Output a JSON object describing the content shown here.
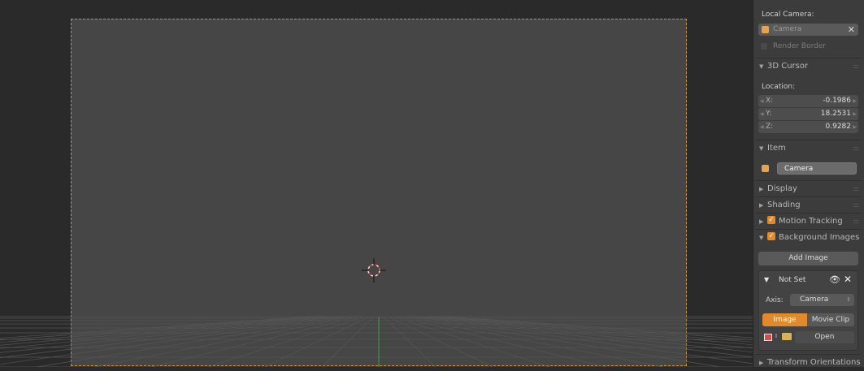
{
  "viewport": {
    "frame_color": "#c8903f",
    "grid_axis_color": "#3aa03a"
  },
  "panel": {
    "local_camera_label": "Local Camera:",
    "local_camera_value": "Camera",
    "render_border_label": "Render Border",
    "cursor_section": "3D Cursor",
    "location_label": "Location:",
    "x_label": "X:",
    "x_value": "-0.1986",
    "y_label": "Y:",
    "y_value": "18.2531",
    "z_label": "Z:",
    "z_value": "0.9282",
    "item_section": "Item",
    "item_name": "Camera",
    "display_section": "Display",
    "shading_section": "Shading",
    "motion_tracking_section": "Motion Tracking",
    "background_images_section": "Background Images",
    "add_image_label": "Add Image",
    "image_entry_title": "Not Set",
    "axis_label": "Axis:",
    "axis_value": "Camera",
    "source_image_label": "Image",
    "source_movie_clip_label": "Movie Clip",
    "open_label": "Open",
    "transform_orientations_section": "Transform Orientations",
    "accent_color": "#e08a2c"
  }
}
